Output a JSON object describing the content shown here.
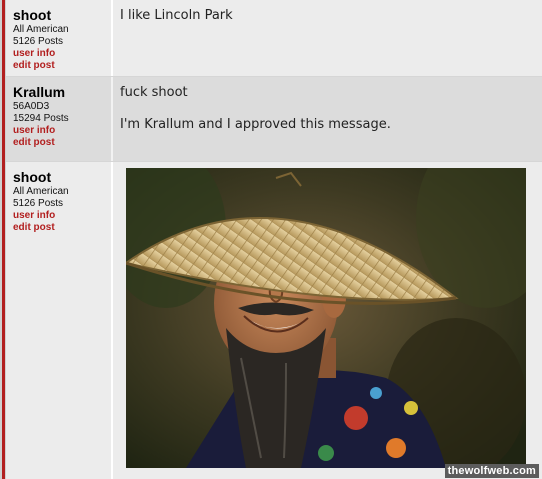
{
  "posts": [
    {
      "username": "shoot",
      "rank": "All American",
      "post_count": "5126 Posts",
      "user_info_label": "user info",
      "edit_post_label": "edit post",
      "lines": [
        "I like Lincoln Park"
      ]
    },
    {
      "username": "Krallum",
      "rank": "56A0D3",
      "post_count": "15294 Posts",
      "user_info_label": "user info",
      "edit_post_label": "edit post",
      "lines": [
        "fuck shoot",
        "I'm Krallum and I approved this message."
      ]
    },
    {
      "username": "shoot",
      "rank": "All American",
      "post_count": "5126 Posts",
      "user_info_label": "user info",
      "edit_post_label": "edit post",
      "image": "smiling-man-in-conical-hat-photo"
    }
  ],
  "footer": {
    "watermark": "thewolfweb.com"
  },
  "colors": {
    "accent_red": "#b21f1f",
    "row_light": "#ececec",
    "row_dark": "#dcdcdc"
  }
}
